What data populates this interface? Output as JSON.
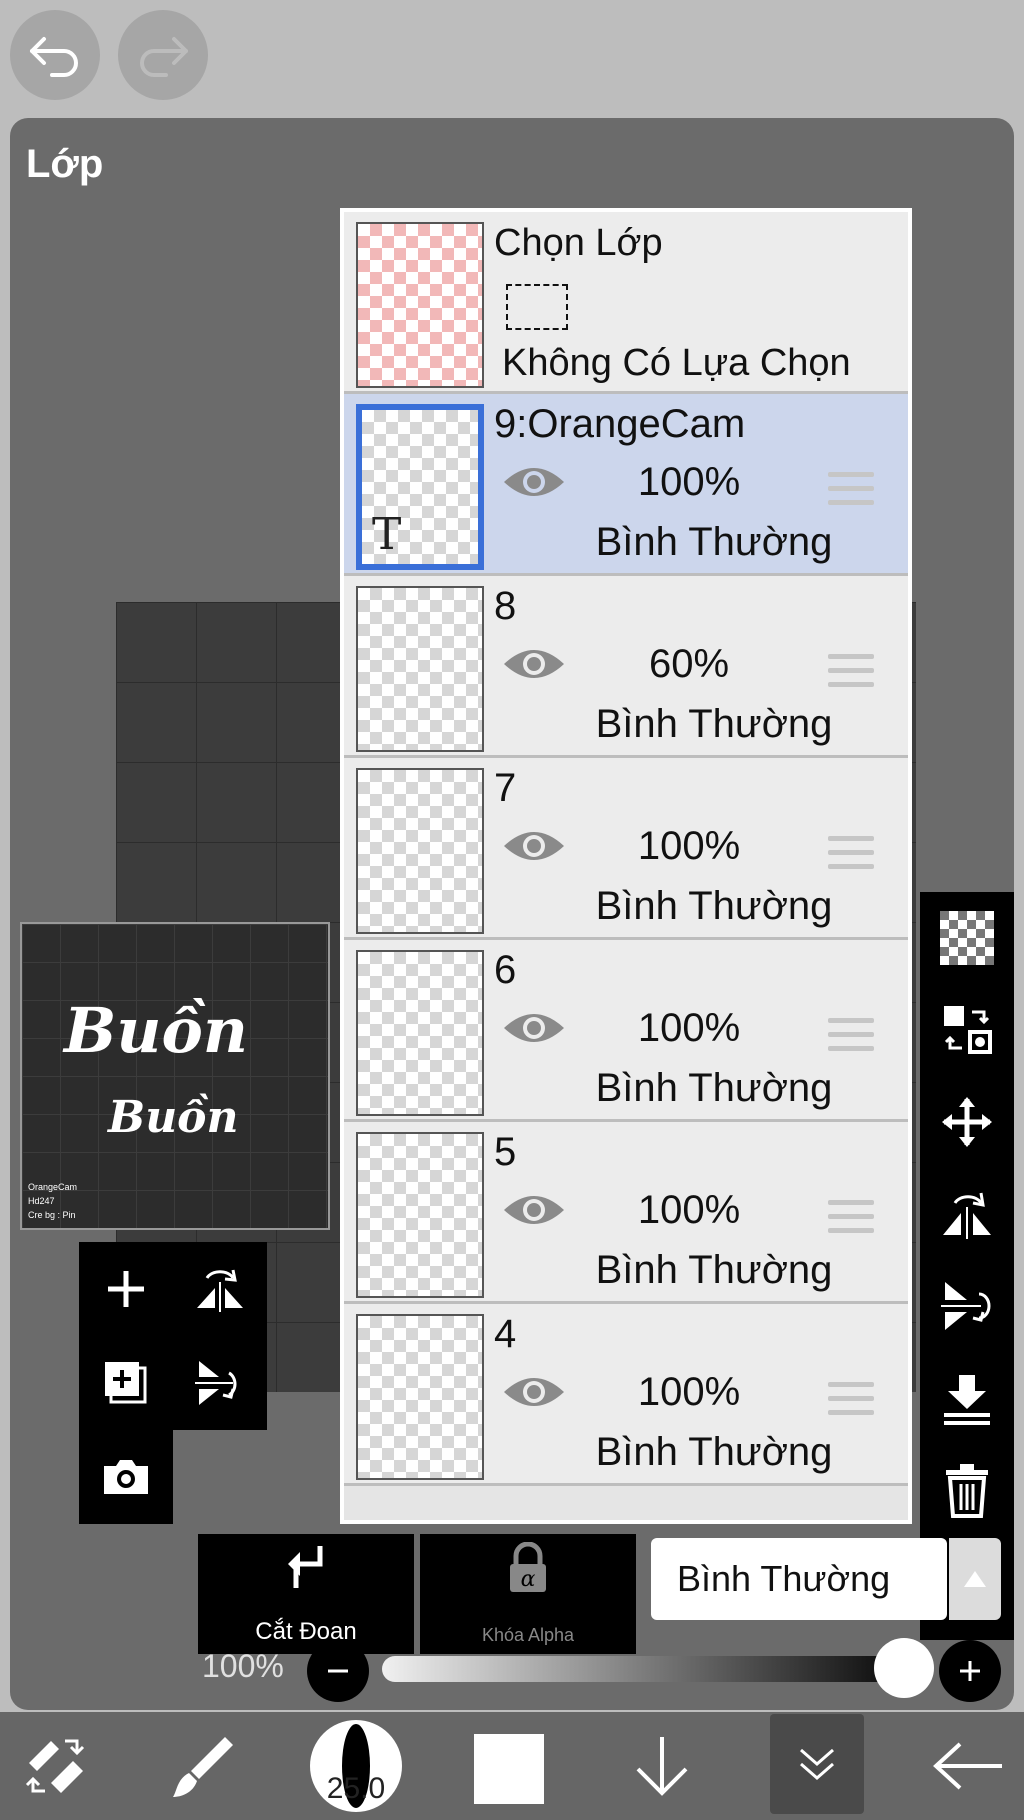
{
  "panel": {
    "title": "Lớp"
  },
  "preview": {
    "big_text": "Buồn",
    "small_text": "Buồn",
    "credits": [
      "OrangeCam",
      "Hd247",
      "Cre bg : Pin"
    ]
  },
  "selection_layer": {
    "title": "Chọn Lớp",
    "subtitle": "Không Có Lựa Chọn"
  },
  "layers": [
    {
      "name": "9:OrangeCam",
      "opacity": "100%",
      "blend": "Bình Thường",
      "selected": true,
      "text_layer": true
    },
    {
      "name": "8",
      "opacity": "60%",
      "blend": "Bình Thường",
      "selected": false
    },
    {
      "name": "7",
      "opacity": "100%",
      "blend": "Bình Thường",
      "selected": false
    },
    {
      "name": "6",
      "opacity": "100%",
      "blend": "Bình Thường",
      "selected": false
    },
    {
      "name": "5",
      "opacity": "100%",
      "blend": "Bình Thường",
      "selected": false
    },
    {
      "name": "4",
      "opacity": "100%",
      "blend": "Bình Thường",
      "selected": false
    }
  ],
  "text_layer_marker": "T",
  "bottom_controls": {
    "clip_label": "Cắt Đoạn",
    "alpha_lock_label": "Khóa Alpha",
    "blend_mode": "Bình Thường",
    "opacity_label": "100%",
    "opacity_value": 1.0
  },
  "toolbar": {
    "brush_size": "25.0",
    "primary_color": "#ffffff"
  },
  "icons": {
    "top": [
      "undo-icon",
      "redo-icon"
    ],
    "left": [
      "add-layer-icon",
      "flip-horizontal-icon",
      "add-image-layer-icon",
      "flip-vertical-icon",
      "camera-icon"
    ],
    "right": [
      "transparency-icon",
      "select-transfer-icon",
      "move-icon",
      "rotate-flip-icon",
      "flip-vertical-rotate-icon",
      "merge-down-icon",
      "trash-icon",
      "more-icon"
    ],
    "bottom": [
      "tool-switch-icon",
      "brush-icon",
      "brush-size-icon",
      "color-icon",
      "down-arrow-icon",
      "layers-icon",
      "back-arrow-icon"
    ]
  }
}
